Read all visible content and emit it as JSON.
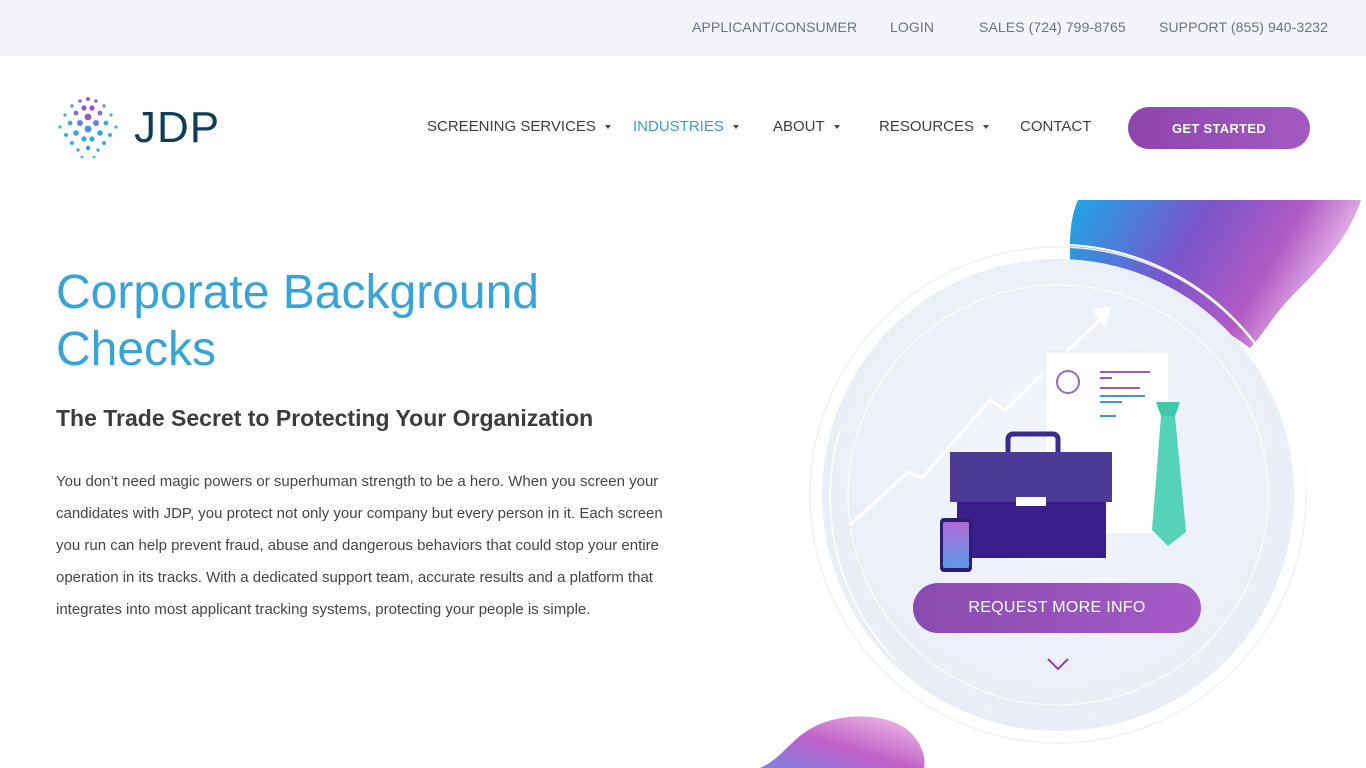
{
  "topbar": {
    "applicant": "APPLICANT/CONSUMER",
    "login": "LOGIN",
    "sales": "SALES (724) 799-8765",
    "support": "SUPPORT (855) 940-3232"
  },
  "logo": {
    "text": "JDP"
  },
  "nav": {
    "screening": "SCREENING SERVICES",
    "industries": "INDUSTRIES",
    "about": "ABOUT",
    "resources": "RESOURCES",
    "contact": "CONTACT",
    "cta": "GET STARTED"
  },
  "hero": {
    "title": "Corporate Background Checks",
    "subtitle": "The Trade Secret to Protecting Your Organization",
    "body": "You don’t need magic powers or superhuman strength to be a hero. When you screen your candidates with JDP, you protect not only your company but every person in it. Each screen you run can help prevent fraud, abuse and dangerous behaviors that could stop your entire operation in its tracks. With a dedicated support team, accurate results and a platform that integrates into most applicant tracking systems, protecting your people is simple.",
    "request_button": "REQUEST MORE INFO"
  },
  "colors": {
    "accent_blue": "#36a3d9",
    "purple": "#8e44ad",
    "navy_logo": "#0f3d57",
    "teal_tie": "#4fd1b8"
  }
}
